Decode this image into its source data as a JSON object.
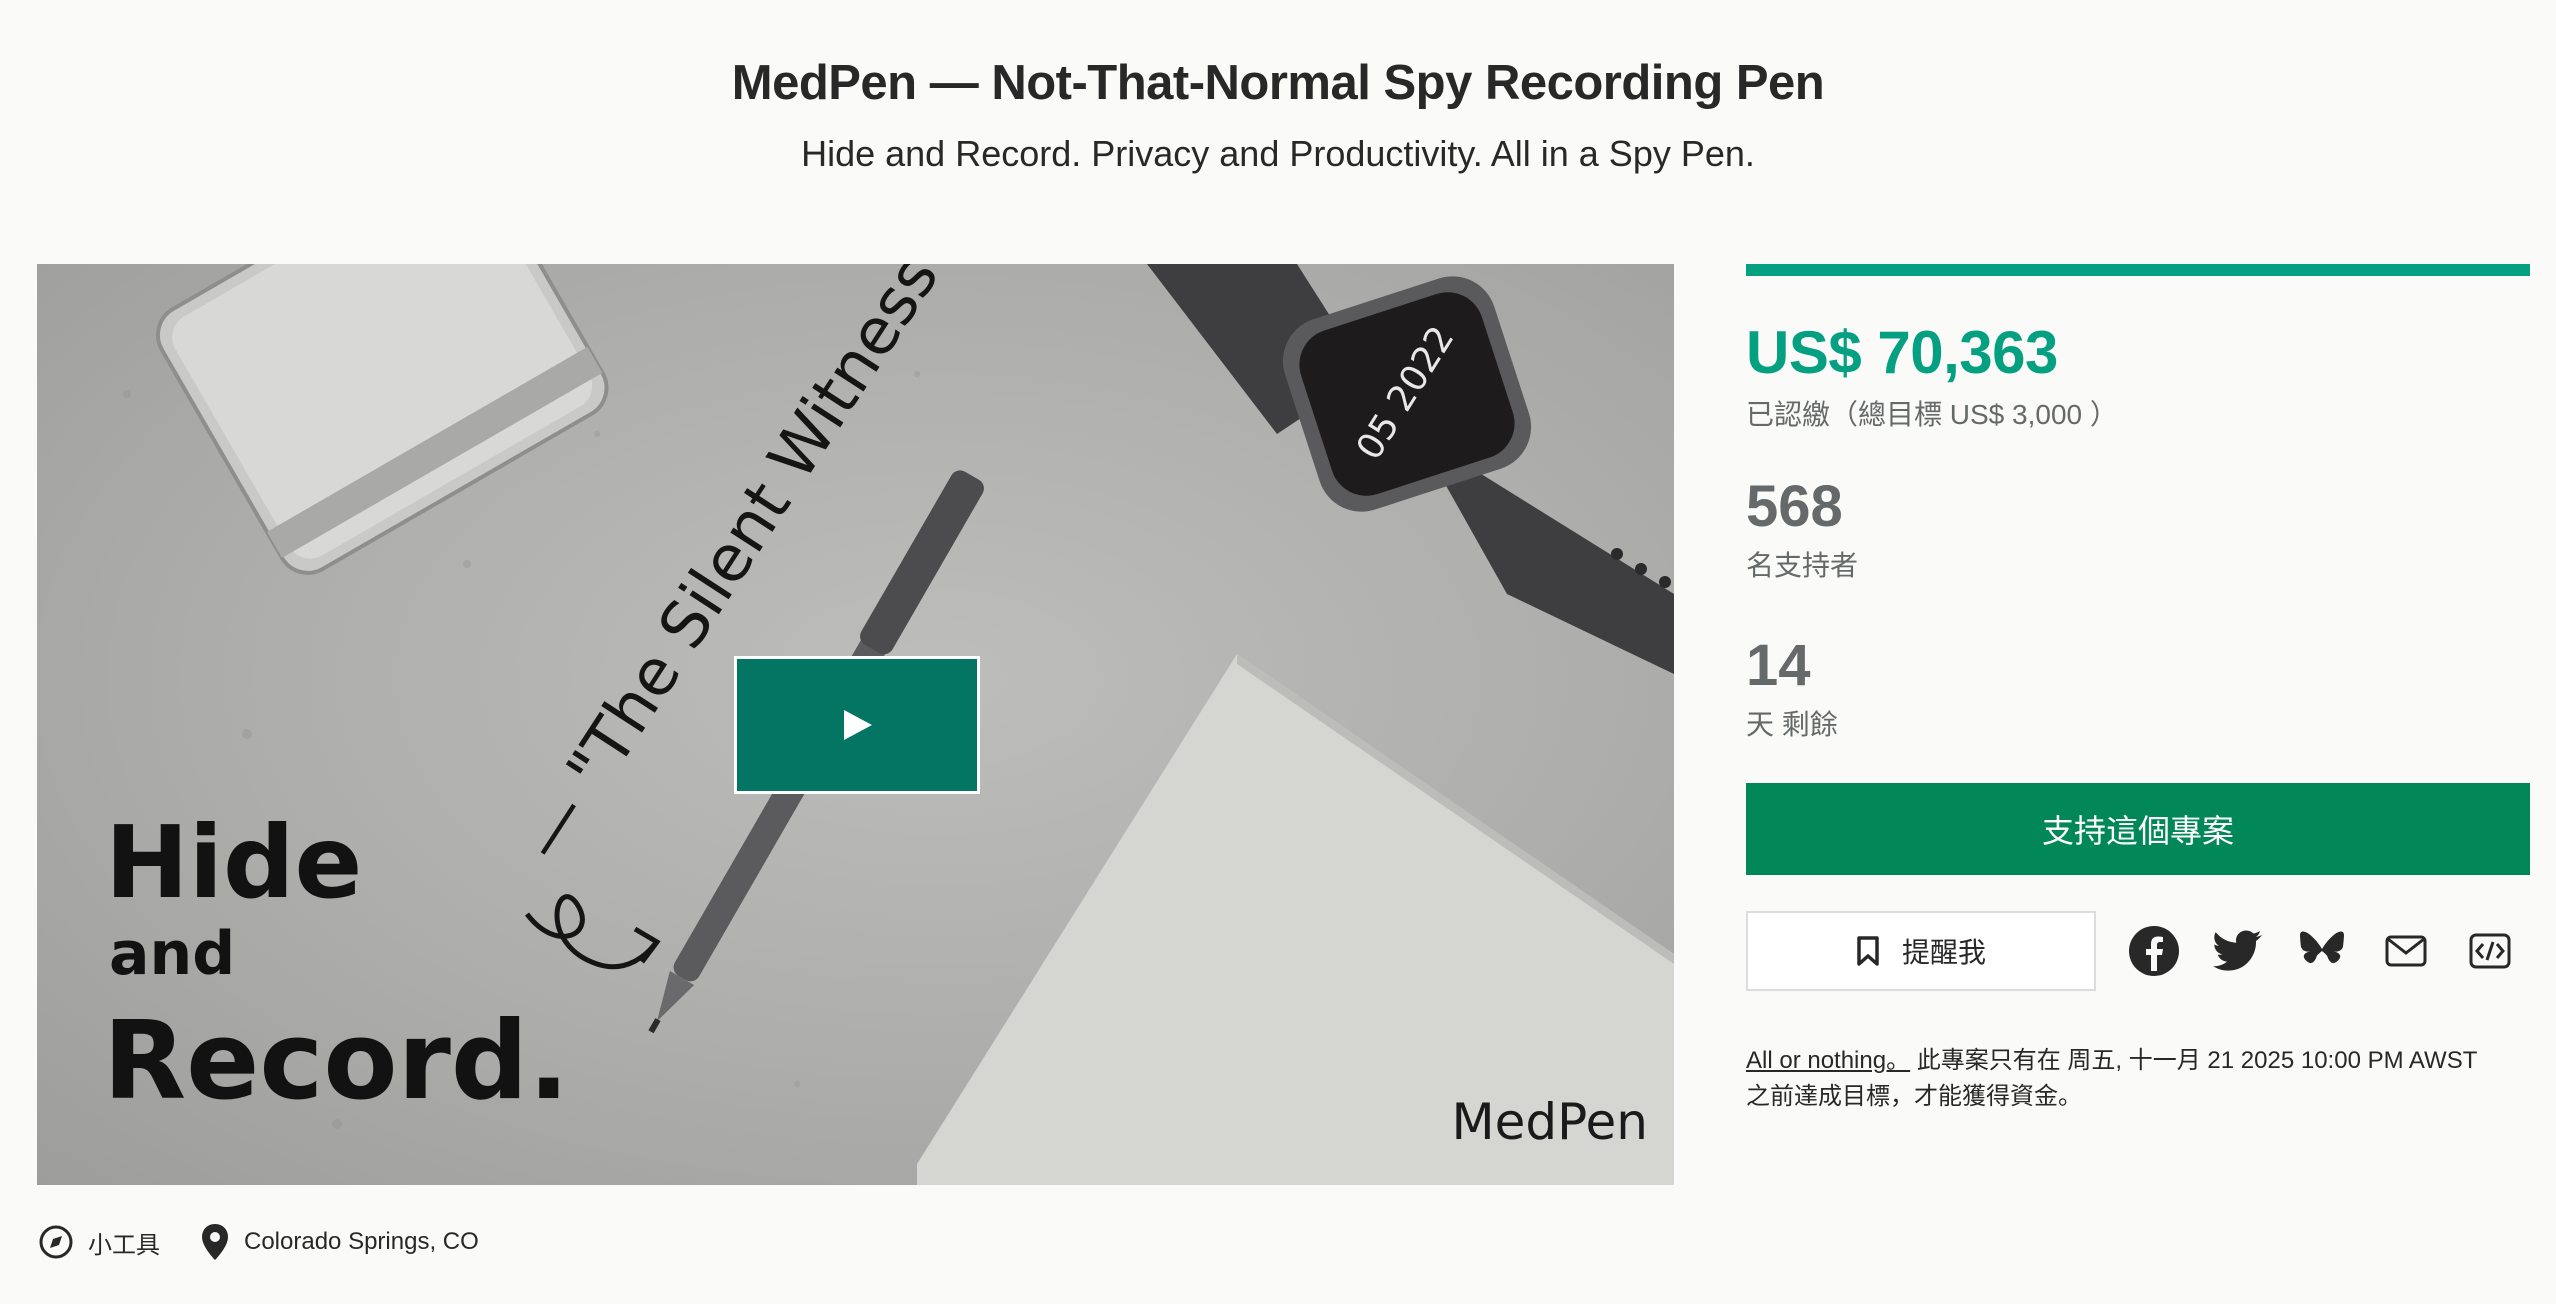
{
  "project": {
    "title": "MedPen — Not-That-Normal Spy Recording Pen",
    "subtitle": "Hide and Record. Privacy and Productivity. All in a Spy Pen."
  },
  "hero": {
    "line1": "Hide",
    "line2": "and",
    "line3": "Record.",
    "quote": "— \"The Silent Witness\"",
    "brand": "MedPen",
    "watch_text_1": "05 2022",
    "play_icon": "play-icon"
  },
  "meta": {
    "category": "小工具",
    "category_icon": "compass-icon",
    "location": "Colorado Springs, CO",
    "location_icon": "map-pin-icon"
  },
  "funding": {
    "progress_fraction": 1.0,
    "pledged": "US$ 70,363",
    "goal": "已認繳（總目標 US$ 3,000 ）",
    "backers": "568",
    "backers_label": "名支持者",
    "days": "14",
    "days_label": "天 剩餘"
  },
  "actions": {
    "back_label": "支持這個專案",
    "remind_label": "提醒我",
    "share_icons": [
      "facebook-icon",
      "twitter-icon",
      "bluesky-icon",
      "email-icon",
      "embed-icon"
    ]
  },
  "notice": {
    "link": "All or nothing。",
    "text_1": " 此專案只有在 周五, 十一月 21 2025 10:00 PM AWST",
    "text_2": "之前達成目標，才能獲得資金。"
  },
  "colors": {
    "accent_green": "#05a081",
    "button_green": "#028858",
    "play_green": "#047463",
    "muted_text": "#656969"
  }
}
